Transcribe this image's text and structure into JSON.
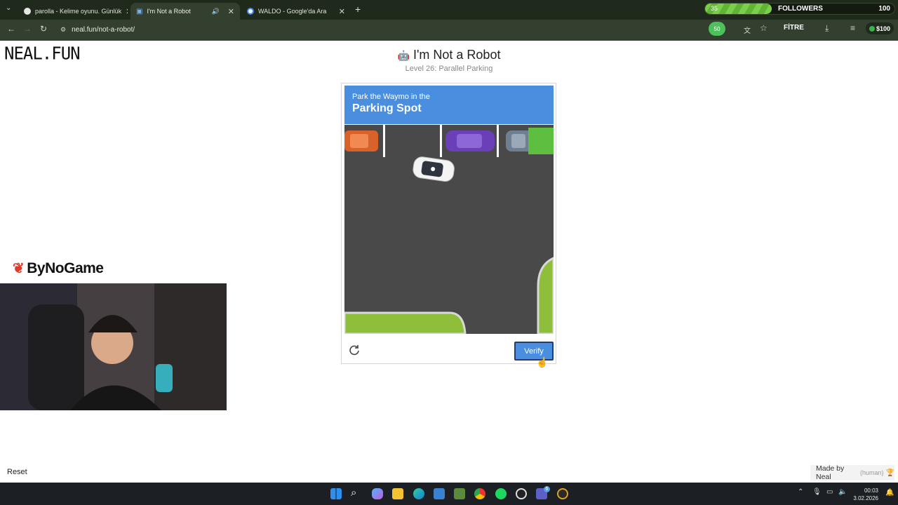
{
  "browser": {
    "tabs": [
      {
        "label": "parolla - Kelime oyunu. Günlük"
      },
      {
        "label": "I'm Not a Robot"
      },
      {
        "label": "WALDO - Google'da Ara"
      }
    ],
    "url": "neal.fun/not-a-robot/",
    "followers": {
      "count": "35",
      "label": "FOLLOWERS",
      "goal": "100",
      "progress_fraction": 0.35
    },
    "ext_badge": "50",
    "filter_label": "FİTRE",
    "money": "$100"
  },
  "page": {
    "logo": "NEAL.FUN",
    "title": "I'm Not a Robot",
    "subtitle": "Level 26: Parallel Parking",
    "captcha": {
      "instruction": "Park the Waymo in the",
      "target": "Parking Spot",
      "verify_label": "Verify"
    },
    "reset_label": "Reset",
    "made_by": "Made by Neal",
    "made_by_human": "(human)"
  },
  "overlay": {
    "brand": "ByNoGame"
  },
  "taskbar": {
    "time": "00:03",
    "date": "3.02.2026",
    "teams_badge": "6"
  },
  "colors": {
    "captcha_blue": "#4a8fdf",
    "asphalt": "#494949",
    "grass": "#8fbf3a"
  }
}
